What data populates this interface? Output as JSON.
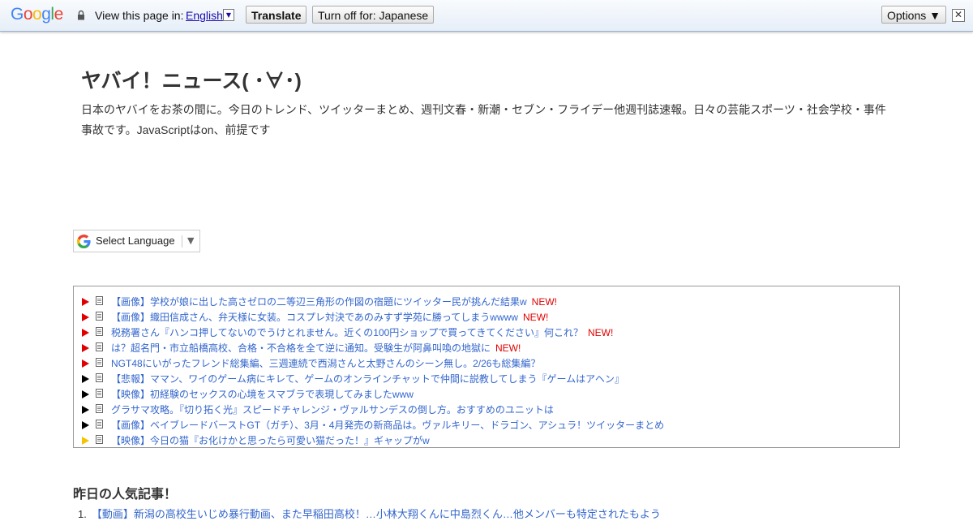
{
  "translate_bar": {
    "logo": "Google",
    "view_label": "View this page in:",
    "language": "English",
    "dropdown_glyph": "▼",
    "translate_button": "Translate",
    "turn_off_button": "Turn off for: Japanese",
    "options_button": "Options ▼",
    "close_glyph": "✕"
  },
  "site": {
    "title": "ヤバイ！ニュース( ･∀･)",
    "description": "日本のヤバイをお茶の間に。今日のトレンド、ツイッターまとめ、週刊文春・新潮・セブン・フライデー他週刊誌速報。日々の芸能スポーツ・社会学校・事件事故です。JavaScriptはon、前提です"
  },
  "language_select": {
    "label": "Select Language",
    "arrow": "▼"
  },
  "news": {
    "new_label": "NEW!",
    "items": [
      {
        "text": "【画像】学校が娘に出した高さゼロの二等辺三角形の作図の宿題にツイッター民が挑んだ結果w",
        "is_new": true,
        "marker_color": "#e00000"
      },
      {
        "text": "【画像】織田信成さん、弁天様に女装。コスプレ対決であのみすず学苑に勝ってしまうwwww",
        "is_new": true,
        "marker_color": "#e00000"
      },
      {
        "text": "税務署さん『ハンコ押してないのでうけとれません。近くの100円ショップで買ってきてください』何これ？",
        "is_new": true,
        "marker_color": "#e00000"
      },
      {
        "text": "は？超名門・市立船橋高校、合格・不合格を全て逆に通知。受験生が阿鼻叫喚の地獄に",
        "is_new": true,
        "marker_color": "#e00000"
      },
      {
        "text": "NGT48にいがったフレンド総集編、三週連続で西潟さんと太野さんのシーン無し。2/26も総集編？",
        "is_new": false,
        "marker_color": "#e00000"
      },
      {
        "text": "【悲報】ママン、ワイのゲーム病にキレて、ゲームのオンラインチャットで仲間に説教してしまう『ゲームはアヘン』",
        "is_new": false,
        "marker_color": "#000000"
      },
      {
        "text": "【映像】初経験のセックスの心境をスマブラで表現してみましたwww",
        "is_new": false,
        "marker_color": "#000000"
      },
      {
        "text": "グラサマ攻略。『切り拓く光』スピードチャレンジ・ヴァルサンデスの倒し方。おすすめのユニットは",
        "is_new": false,
        "marker_color": "#000000"
      },
      {
        "text": "【画像】ベイブレードバーストGT（ガチ）、3月・4月発売の新商品は。ヴァルキリー、ドラゴン、アシュラ！ツイッターまとめ",
        "is_new": false,
        "marker_color": "#000000"
      },
      {
        "text": "【映像】今日の猫『お化けかと思ったら可愛い猫だった！』ギャップがw",
        "is_new": false,
        "marker_color": "#f5c400"
      }
    ]
  },
  "popular": {
    "title": "昨日の人気記事！",
    "items": [
      {
        "num": "1.",
        "text": "【動画】新潟の高校生いじめ暴行動画、また早稲田高校！…小林大翔くんに中島烈くん…他メンバーも特定されたもよう"
      }
    ]
  }
}
